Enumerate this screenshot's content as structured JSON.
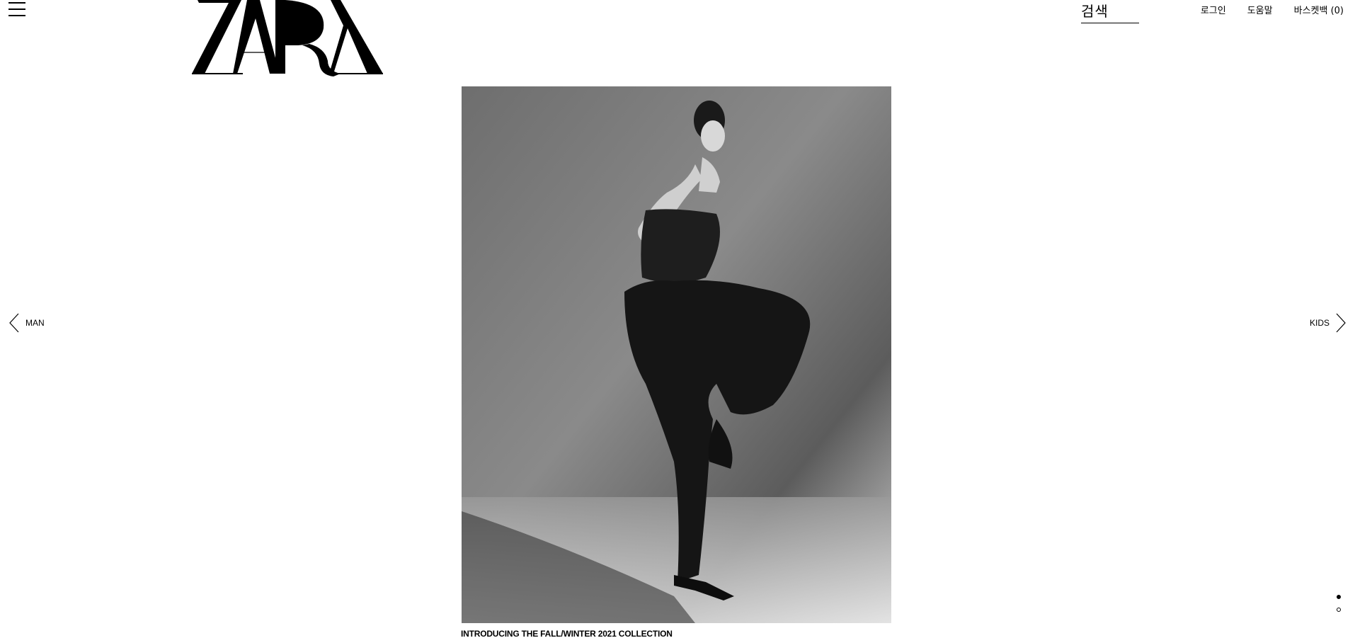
{
  "header": {
    "menu_icon": "hamburger-menu-icon",
    "logo_text": "ZARA",
    "search_label": "검색",
    "nav": {
      "login": "로그인",
      "help": "도움말",
      "basket": "바스켓백 (0)"
    }
  },
  "hero": {
    "caption": "INTRODUCING THE FALL/WINTER 2021 COLLECTION"
  },
  "navigation": {
    "prev_label": "MAN",
    "prev_icon": "chevron-left-icon",
    "next_label": "KIDS",
    "next_icon": "chevron-right-icon"
  },
  "carousel": {
    "slides": 2,
    "active_index": 0
  },
  "colors": {
    "text": "#000000",
    "background": "#ffffff"
  }
}
